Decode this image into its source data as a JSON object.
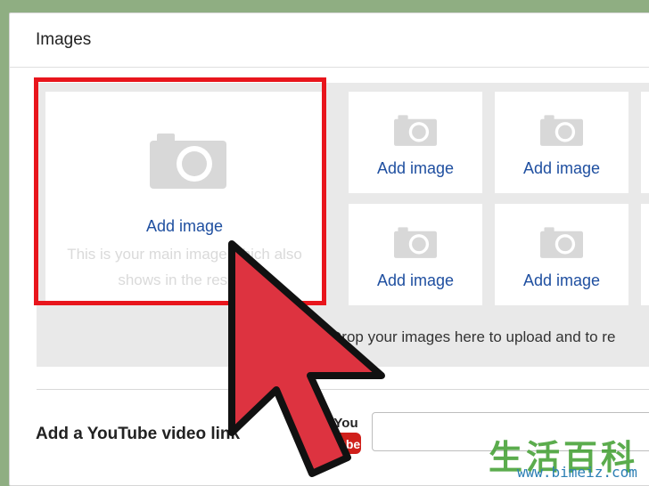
{
  "images_section": {
    "title": "Images",
    "main_slot": {
      "label": "Add image",
      "description": "This is your main image which also shows in the results"
    },
    "slots": [
      {
        "label": "Add image"
      },
      {
        "label": "Add image"
      },
      {
        "label": "Add image"
      },
      {
        "label": "Add image"
      }
    ],
    "drop_hint": "Drop your images here to upload and to re"
  },
  "youtube": {
    "label": "Add a YouTube video link",
    "logo_text_top": "You",
    "logo_text_bottom": "Tube",
    "input_value": ""
  },
  "watermark": {
    "chars": "生活百科",
    "url": "www.bimeiz.com"
  },
  "colors": {
    "highlight_outline": "#e8151c",
    "link_blue": "#1f4fa0",
    "cursor_red": "#dd3340",
    "background_green": "#8fae82"
  }
}
